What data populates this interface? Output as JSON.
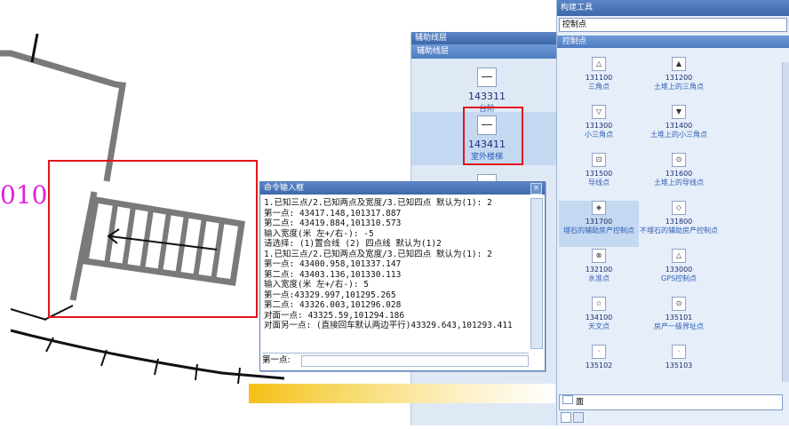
{
  "cad": {
    "label_010": "010"
  },
  "aux_panel": {
    "title": "辅助线层",
    "header": "辅助线层",
    "items": [
      {
        "code": "143311",
        "name": "台阶"
      },
      {
        "code": "143411",
        "name": "室外楼梯"
      }
    ]
  },
  "tool_panel": {
    "title": "构建工具",
    "search_value": "控制点",
    "category": "控制点",
    "items": [
      {
        "code": "131100",
        "name": "三角点",
        "glyph": "△"
      },
      {
        "code": "131200",
        "name": "土堆上的三角点",
        "glyph": "▲"
      },
      {
        "code": "131300",
        "name": "小三角点",
        "glyph": "▽"
      },
      {
        "code": "131400",
        "name": "土堆上的小三角点",
        "glyph": "▼"
      },
      {
        "code": "131500",
        "name": "导线点",
        "glyph": "⊡"
      },
      {
        "code": "131600",
        "name": "土堆上的导线点",
        "glyph": "⊙"
      },
      {
        "code": "131700",
        "name": "埋石的辅助房产控制点",
        "glyph": "◈"
      },
      {
        "code": "131800",
        "name": "不埋石的辅助房产控制点",
        "glyph": "◇"
      },
      {
        "code": "132100",
        "name": "水准点",
        "glyph": "⊗"
      },
      {
        "code": "133000",
        "name": "GPS控制点",
        "glyph": "△"
      },
      {
        "code": "134100",
        "name": "天文点",
        "glyph": "☆"
      },
      {
        "code": "135101",
        "name": "房产一级界址点",
        "glyph": "⊙"
      },
      {
        "code": "135102",
        "name": "",
        "glyph": "·"
      },
      {
        "code": "135103",
        "name": "",
        "glyph": "·"
      }
    ],
    "layer_label": "面"
  },
  "command_dialog": {
    "title": "命令输入框",
    "lines": [
      "1.已知三点/2.已知两点及宽度/3.已知四点 默认为(1): 2",
      "第一点: 43417.148,101317.887",
      "第二点: 43419.884,101310.573",
      "输入宽度(米 左+/右-): -5",
      "请选择: (1)置合线 (2) 四点线 默认为(1)2",
      "1.已知三点/2.已知两点及宽度/3.已知四点 默认为(1): 2",
      "第一点: 43400.958,101337.147",
      "第二点: 43403.136,101330.113",
      "输入宽度(米 左+/右-): 5",
      "第一点:43329.997,101295.265",
      "第二点: 43326.003,101296.028",
      "对面一点: 43325.59,101294.186",
      "对面另一点: (直接回车默认两边平行)43329.643,101293.411"
    ],
    "prompt_label": "第一点:",
    "close_glyph": "×"
  },
  "colors": {
    "accent": "#e3141b",
    "title_blue": "#3d68aa",
    "magenta_text": "#e020e0"
  }
}
